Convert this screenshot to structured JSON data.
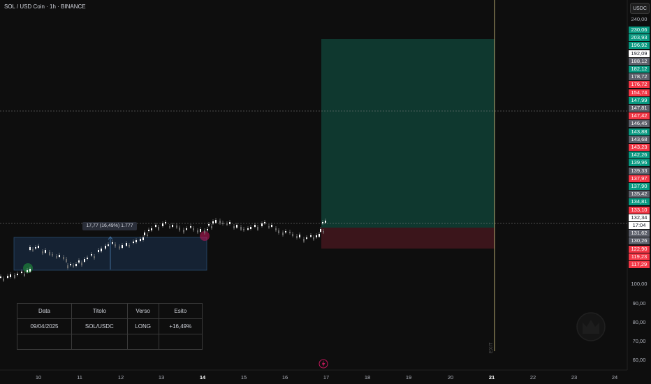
{
  "header": {
    "symbol_title": "SOL / USD Coin · 1h · BINANCE",
    "scale_currency": "USDC"
  },
  "y_axis_labels": [
    "240,00",
    "100,00",
    "90,00",
    "80,00",
    "70,00",
    "60,00"
  ],
  "price_labels": [
    {
      "text": "230,06",
      "color": "green"
    },
    {
      "text": "203,93",
      "color": "green"
    },
    {
      "text": "196,92",
      "color": "green"
    },
    {
      "text": "192,09",
      "color": "white"
    },
    {
      "text": "188,12",
      "color": "gray"
    },
    {
      "text": "182,12",
      "color": "green"
    },
    {
      "text": "178,72",
      "color": "gray"
    },
    {
      "text": "176,72",
      "color": "red"
    },
    {
      "text": "154,74",
      "color": "red"
    },
    {
      "text": "147,99",
      "color": "green"
    },
    {
      "text": "147,81",
      "color": "gray"
    },
    {
      "text": "147,42",
      "color": "red"
    },
    {
      "text": "146,45",
      "color": "gray"
    },
    {
      "text": "143,88",
      "color": "green"
    },
    {
      "text": "143,68",
      "color": "gray"
    },
    {
      "text": "143,23",
      "color": "red"
    },
    {
      "text": "142,26",
      "color": "green"
    },
    {
      "text": "139,96",
      "color": "green"
    },
    {
      "text": "139,33",
      "color": "gray"
    },
    {
      "text": "137,97",
      "color": "red"
    },
    {
      "text": "137,90",
      "color": "green"
    },
    {
      "text": "135,42",
      "color": "gray"
    },
    {
      "text": "134,81",
      "color": "green"
    },
    {
      "text": "133,10",
      "color": "red"
    },
    {
      "text": "132,34",
      "color": "white"
    },
    {
      "text": "17:04",
      "color": "white"
    },
    {
      "text": "131,62",
      "color": "gray"
    },
    {
      "text": "130,26",
      "color": "gray"
    },
    {
      "text": "122,90",
      "color": "red"
    },
    {
      "text": "119,23",
      "color": "red"
    },
    {
      "text": "117,29",
      "color": "red"
    }
  ],
  "x_axis_labels": [
    {
      "text": "10",
      "bold": false
    },
    {
      "text": "11",
      "bold": false
    },
    {
      "text": "12",
      "bold": false
    },
    {
      "text": "13",
      "bold": false
    },
    {
      "text": "14",
      "bold": true
    },
    {
      "text": "15",
      "bold": false
    },
    {
      "text": "16",
      "bold": false
    },
    {
      "text": "17",
      "bold": false
    },
    {
      "text": "18",
      "bold": false
    },
    {
      "text": "19",
      "bold": false
    },
    {
      "text": "20",
      "bold": false
    },
    {
      "text": "21",
      "bold": true
    },
    {
      "text": "22",
      "bold": false
    },
    {
      "text": "23",
      "bold": false
    },
    {
      "text": "24",
      "bold": false
    }
  ],
  "range_tooltip": "17,77 (16,49%) 1.777",
  "exit_label": "EXIT",
  "trade_table": {
    "headers": [
      "Data",
      "Titolo",
      "Verso",
      "Esito"
    ],
    "rows": [
      [
        "09/04/2025",
        "SOL/USDC",
        "LONG",
        "+16,49%"
      ],
      [
        "",
        "",
        "",
        ""
      ]
    ]
  },
  "colors": {
    "background": "#0e0e0e",
    "profit_zone": "#0f3a30",
    "loss_zone": "#3a1419",
    "range_box": "#1a2838",
    "up_candle": "#ffffff",
    "vertical_line": "#e2d48a"
  }
}
